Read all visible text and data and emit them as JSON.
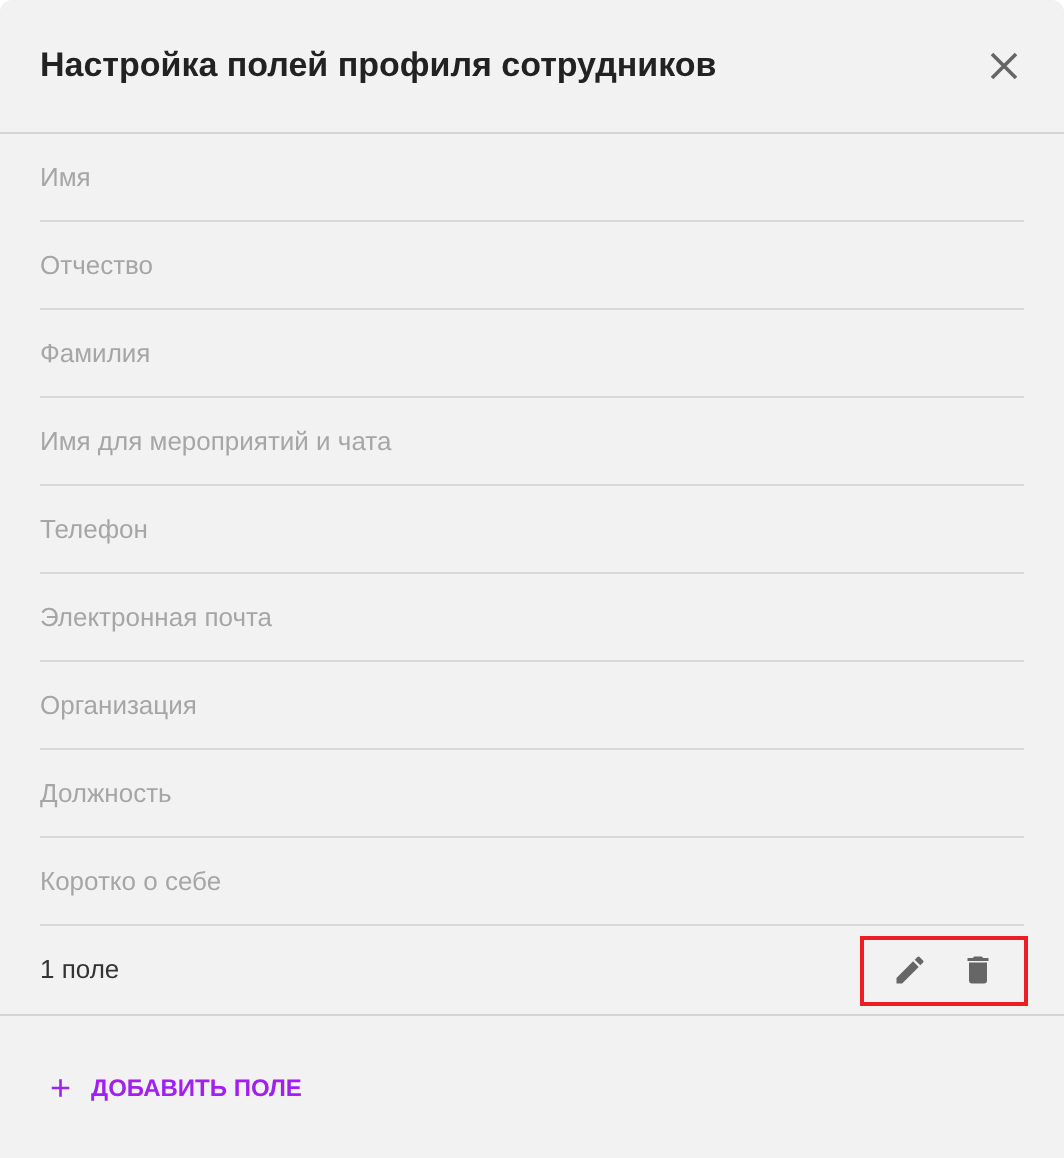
{
  "dialog": {
    "title": "Настройка полей профиля сотрудников"
  },
  "fields": [
    {
      "label": "Имя",
      "kind": "default"
    },
    {
      "label": "Отчество",
      "kind": "default"
    },
    {
      "label": "Фамилия",
      "kind": "default"
    },
    {
      "label": "Имя для мероприятий и чата",
      "kind": "default"
    },
    {
      "label": "Телефон",
      "kind": "default"
    },
    {
      "label": "Электронная почта",
      "kind": "default"
    },
    {
      "label": "Организация",
      "kind": "default"
    },
    {
      "label": "Должность",
      "kind": "default"
    },
    {
      "label": "Коротко о себе",
      "kind": "default"
    },
    {
      "label": "1 поле",
      "kind": "custom",
      "highlighted": true
    }
  ],
  "add_button": {
    "icon": "+",
    "label": "ДОБАВИТЬ ПОЛЕ"
  }
}
